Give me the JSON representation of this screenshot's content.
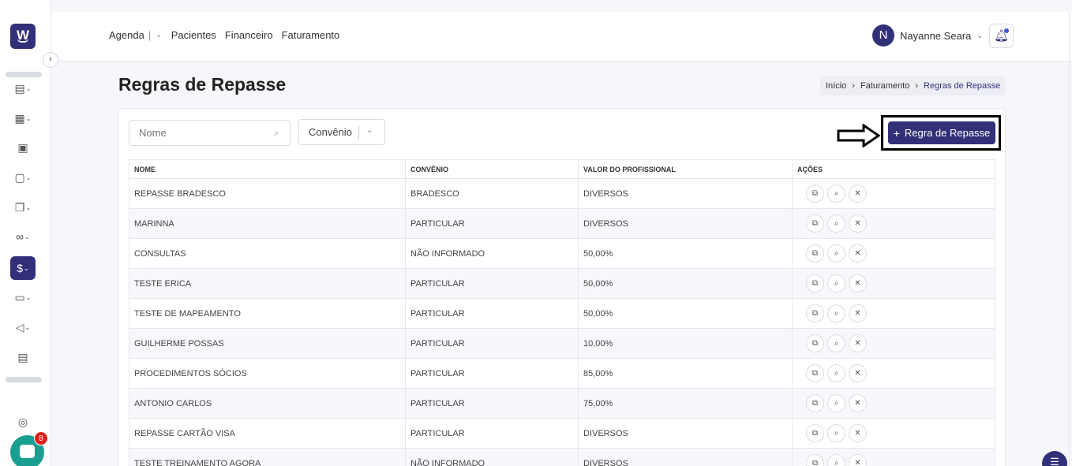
{
  "sidebar": {
    "logo_text": "W",
    "collapse_icon": "chevron-right-icon",
    "items": [
      {
        "name": "list",
        "glyph": "▤",
        "has_dropdown": true
      },
      {
        "name": "calendar",
        "glyph": "▦",
        "has_dropdown": true
      },
      {
        "name": "patient",
        "glyph": "▣",
        "has_dropdown": false
      },
      {
        "name": "briefcase",
        "glyph": "▢",
        "has_dropdown": true
      },
      {
        "name": "documents",
        "glyph": "❐",
        "has_dropdown": true
      },
      {
        "name": "handshake",
        "glyph": "∞",
        "has_dropdown": true
      },
      {
        "name": "billing",
        "glyph": "$",
        "has_dropdown": true,
        "active": true
      },
      {
        "name": "monitor",
        "glyph": "▭",
        "has_dropdown": true
      },
      {
        "name": "megaphone",
        "glyph": "◁",
        "has_dropdown": true
      },
      {
        "name": "report",
        "glyph": "▤",
        "has_dropdown": false
      },
      {
        "name": "support",
        "glyph": "◎",
        "has_dropdown": false
      }
    ],
    "chat_badge": "8"
  },
  "topbar": {
    "nav": {
      "agenda": "Agenda",
      "pacientes": "Pacientes",
      "financeiro": "Financeiro",
      "faturamento": "Faturamento"
    },
    "user": {
      "initial": "N",
      "name": "Nayanne Seara"
    }
  },
  "page": {
    "title": "Regras de Repasse",
    "breadcrumb": {
      "home": "Início",
      "parent": "Faturamento",
      "current": "Regras de Repasse"
    }
  },
  "filters": {
    "name_placeholder": "Nome",
    "convenio_label": "Convênio"
  },
  "add_button": {
    "label": "Regra de Repasse"
  },
  "table": {
    "headers": {
      "nome": "NOME",
      "convenio": "CONVÊNIO",
      "valor": "VALOR DO PROFISSIONAL",
      "acoes": "AÇÕES"
    },
    "rows": [
      {
        "nome": "REPASSE BRADESCO",
        "convenio": "BRADESCO",
        "valor": "DIVERSOS"
      },
      {
        "nome": "MARINNA",
        "convenio": "PARTICULAR",
        "valor": "DIVERSOS"
      },
      {
        "nome": "CONSULTAS",
        "convenio": "NÃO INFORMADO",
        "valor": "50,00%"
      },
      {
        "nome": "TESTE ERICA",
        "convenio": "PARTICULAR",
        "valor": "50,00%"
      },
      {
        "nome": "TESTE DE MAPEAMENTO",
        "convenio": "PARTICULAR",
        "valor": "50,00%"
      },
      {
        "nome": "GUILHERME POSSAS",
        "convenio": "PARTICULAR",
        "valor": "10,00%"
      },
      {
        "nome": "PROCEDIMENTOS SÓCIOS",
        "convenio": "PARTICULAR",
        "valor": "85,00%"
      },
      {
        "nome": "ANTONIO CARLOS",
        "convenio": "PARTICULAR",
        "valor": "75,00%"
      },
      {
        "nome": "REPASSE CARTÃO VISA",
        "convenio": "PARTICULAR",
        "valor": "DIVERSOS"
      },
      {
        "nome": "TESTE TREINAMENTO AGORA",
        "convenio": "NÃO INFORMADO",
        "valor": "DIVERSOS"
      }
    ]
  }
}
